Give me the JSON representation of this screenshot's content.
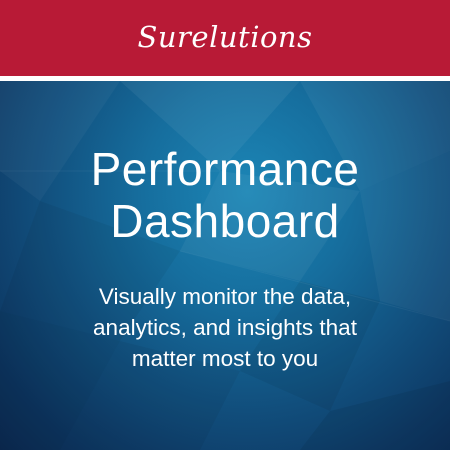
{
  "brand": {
    "name": "Surelutions",
    "bar_color": "#b81a36"
  },
  "hero": {
    "title_lines": [
      "Performance",
      "Dashboard"
    ],
    "subtitle_lines": [
      "Visually monitor the data,",
      "analytics, and insights that",
      "matter most to you"
    ],
    "text_color": "#ffffff"
  }
}
